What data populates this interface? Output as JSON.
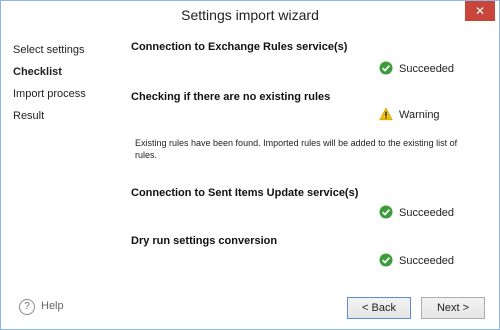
{
  "window": {
    "title": "Settings import wizard",
    "close_icon": "close-icon"
  },
  "sidebar": {
    "items": [
      {
        "label": "Select settings",
        "active": false
      },
      {
        "label": "Checklist",
        "active": true
      },
      {
        "label": "Import process",
        "active": false
      },
      {
        "label": "Result",
        "active": false
      }
    ]
  },
  "checks": [
    {
      "title": "Connection to Exchange Rules service(s)",
      "status": "Succeeded",
      "status_icon": "check-circle-icon"
    },
    {
      "title": "Checking if there are no existing rules",
      "status": "Warning",
      "status_icon": "warning-triangle-icon",
      "message": "Existing rules have been found. Imported rules will be added to the existing list of rules."
    },
    {
      "title": "Connection to Sent Items Update service(s)",
      "status": "Succeeded",
      "status_icon": "check-circle-icon"
    },
    {
      "title": "Dry run settings conversion",
      "status": "Succeeded",
      "status_icon": "check-circle-icon"
    }
  ],
  "footer": {
    "help_label": "Help",
    "back_label": "< Back",
    "next_label": "Next >"
  },
  "colors": {
    "success": "#3a9d3a",
    "warning": "#f2c200",
    "close_bg": "#c8453b",
    "window_border": "#8cb8e6"
  }
}
